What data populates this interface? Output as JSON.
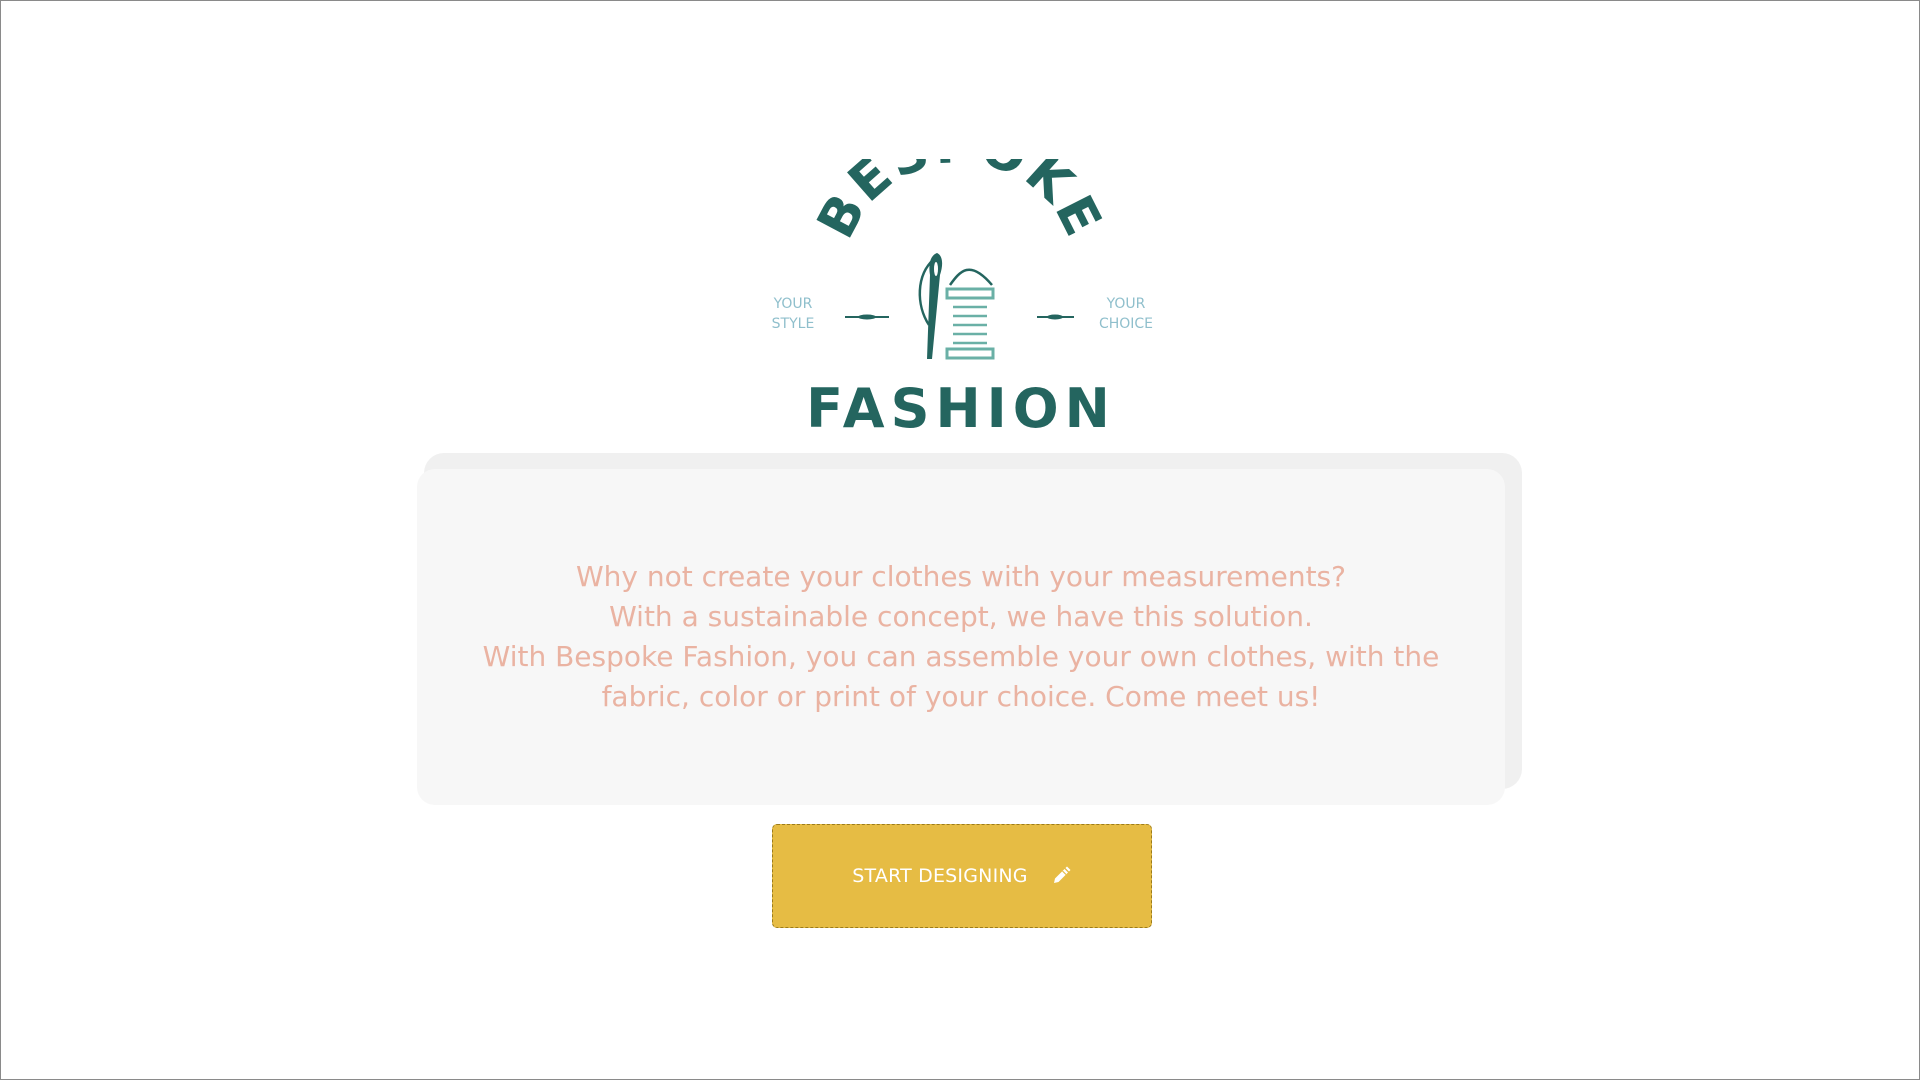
{
  "logo": {
    "brand_top": "BESPOKE",
    "brand_bottom": "FASHION",
    "tagline_left_1": "YOUR",
    "tagline_left_2": "STYLE",
    "tagline_right_1": "YOUR",
    "tagline_right_2": "CHOICE"
  },
  "intro": {
    "line1": "Why not create your clothes with your measurements?",
    "line2": "With a sustainable concept, we have this solution.",
    "line3": "With Bespoke Fashion, you can assemble your own clothes, with the",
    "line4": "fabric, color or print of your choice. Come meet us!"
  },
  "cta": {
    "label": "START DESIGNING",
    "icon": "pencil-icon"
  },
  "colors": {
    "brand_green": "#24655f",
    "accent_teal": "#6ab0a6",
    "tagline_blue": "#8fbfcc",
    "text_salmon": "#eab3a2",
    "button_yellow": "#e6bc44",
    "card_bg": "#f7f7f7"
  }
}
